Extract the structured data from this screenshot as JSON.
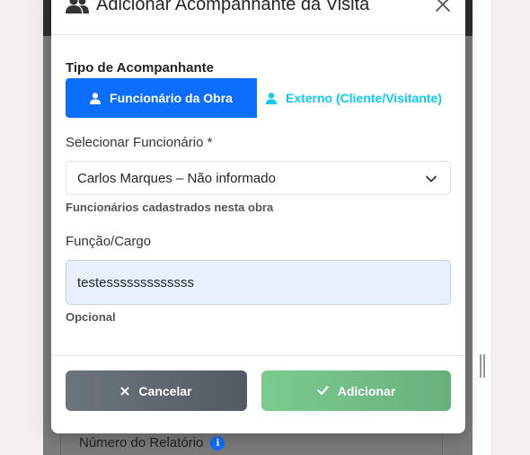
{
  "background": {
    "field_label": "Número do Relatório",
    "info_icon": "i"
  },
  "modal": {
    "title": "Adicionar Acompanhante da Visita",
    "title_icon": "users-icon",
    "close_icon": "close-icon",
    "type_section": {
      "label": "Tipo de Acompanhante",
      "options": [
        {
          "label": "Funcionário da Obra",
          "icon": "user-icon",
          "active": true
        },
        {
          "label": "Externo (Cliente/Visitante)",
          "icon": "user-icon",
          "active": false
        }
      ]
    },
    "employee_field": {
      "label": "Selecionar Funcionário *",
      "selected": "Carlos Marques – Não informado",
      "help": "Funcionários cadastrados nesta obra"
    },
    "role_field": {
      "label": "Função/Cargo",
      "value": "testesssssssssssss",
      "help": "Opcional"
    },
    "footer": {
      "cancel_label": "Cancelar",
      "add_label": "Adicionar"
    }
  },
  "colors": {
    "primary": "#0d6efd",
    "info": "#0dcaf0",
    "success": "#75c08a",
    "secondary": "#6c757d"
  }
}
